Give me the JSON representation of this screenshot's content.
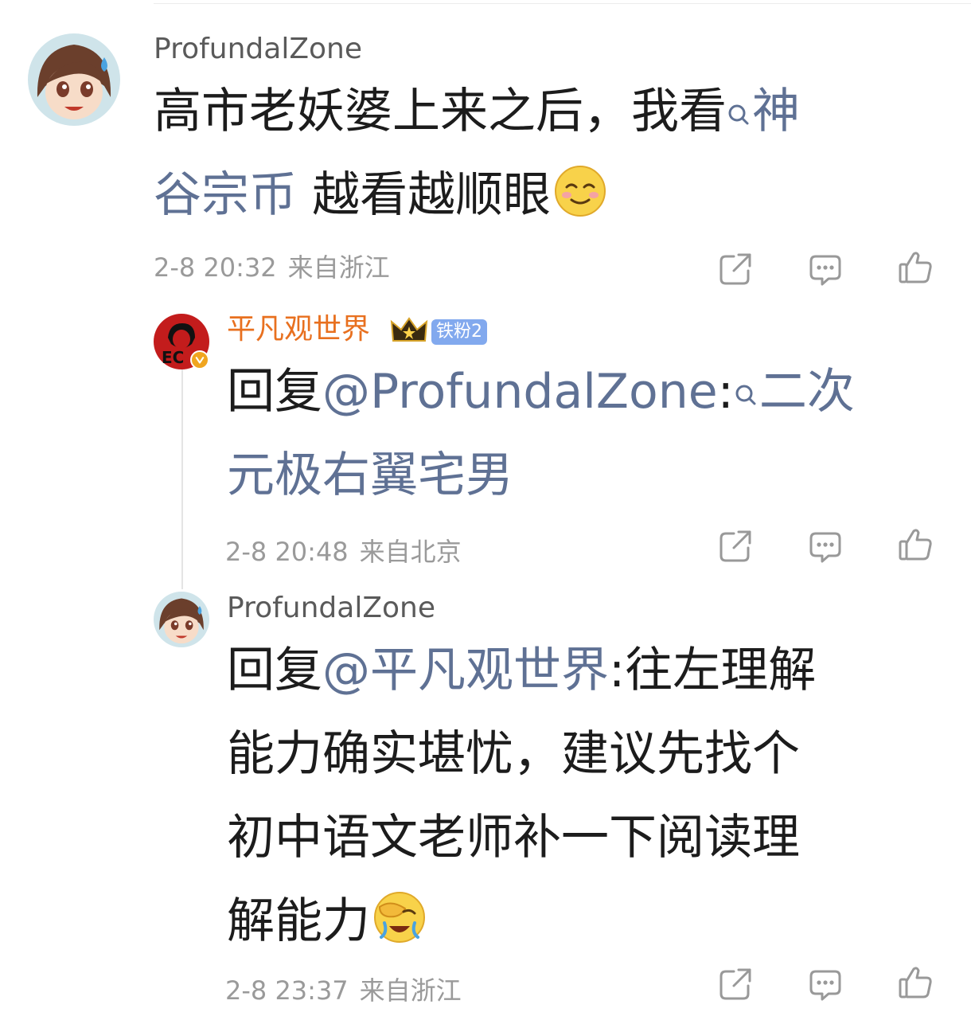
{
  "comments": [
    {
      "username": "ProfundalZone",
      "text_plain": "高市老妖婆上来之后，我看",
      "link_text_1": "神",
      "link_text_2": "谷宗币",
      "text_after": " 越看越顺眼",
      "time": "2-8 20:32",
      "location": "来自浙江"
    },
    {
      "username": "平凡观世界",
      "fan_badge": "铁粉2",
      "reply_prefix": "回复",
      "mention": "@ProfundalZone",
      "colon": ":",
      "link_text_1": "二次",
      "link_text_2": "元极右翼宅男",
      "time": "2-8 20:48",
      "location": "来自北京"
    },
    {
      "username": "ProfundalZone",
      "reply_prefix": "回复",
      "mention": "@平凡观世界",
      "line1_rest": ":往左理解",
      "line2": "能力确实堪忧，建议先找个",
      "line3": "初中语文老师补一下阅读理",
      "line4": "解能力",
      "time": "2-8 23:37",
      "location": "来自浙江"
    }
  ],
  "icons": [
    "share-icon",
    "comment-icon",
    "like-icon",
    "search-icon",
    "smile-emoji-icon",
    "facepalm-emoji-icon",
    "crown-icon",
    "verified-icon"
  ],
  "colors": {
    "link": "#5f7194",
    "username_gray": "#5a5a5a",
    "username_orange": "#e8701f",
    "meta": "#9a9a9a",
    "fan_badge": "#82a9ee"
  }
}
